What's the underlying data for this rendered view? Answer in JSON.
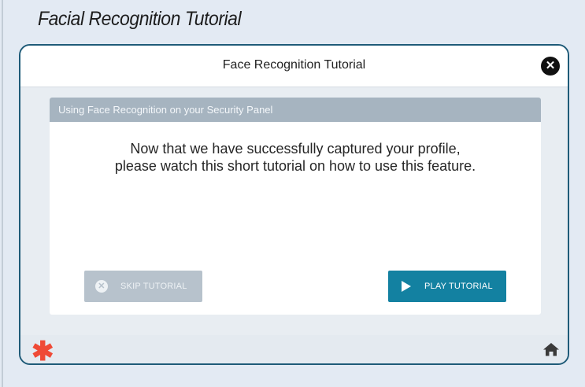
{
  "page": {
    "heading": "Facial Recognition Tutorial"
  },
  "modal": {
    "title": "Face Recognition Tutorial",
    "close_icon": "close-icon"
  },
  "panel": {
    "header": "Using Face Recognition on your Security Panel",
    "message_lines": [
      "Now that we have successfully captured your profile,",
      "please watch this short tutorial on how to use this feature."
    ]
  },
  "buttons": {
    "skip": {
      "label": "SKIP TUTORIAL",
      "icon": "close-circle-icon"
    },
    "play": {
      "label": "PLAY TUTORIAL",
      "icon": "play-icon"
    }
  },
  "footer": {
    "brand_icon": "asterisk-logo",
    "home_icon": "home-icon"
  },
  "colors": {
    "accent": "#1381a1",
    "brand": "#ef4a36",
    "panel_header": "#a6b4c0",
    "modal_border": "#1f5b78"
  }
}
